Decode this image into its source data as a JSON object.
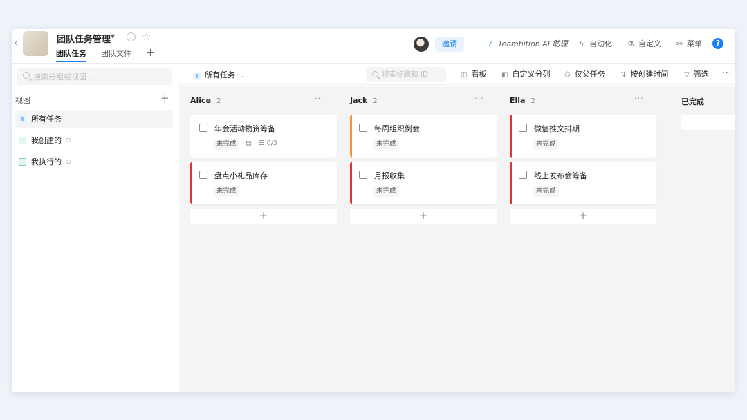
{
  "project": {
    "title": "团队任务管理",
    "tabs": [
      {
        "label": "团队任务"
      },
      {
        "label": "团队文件"
      }
    ]
  },
  "header": {
    "invite_label": "邀请",
    "ai_label": "Teambition AI 助理",
    "automation_label": "自动化",
    "custom_label": "自定义",
    "menu_label": "菜单",
    "help_label": "?"
  },
  "sidebar": {
    "search_placeholder": "搜索分组或视图 ...",
    "section_label": "视图",
    "views": [
      {
        "label": "所有任务",
        "icon": "kanban-icon"
      },
      {
        "label": "我创建的",
        "icon": "table-icon"
      },
      {
        "label": "我执行的",
        "icon": "table-icon"
      }
    ]
  },
  "toolbar": {
    "current_view": "所有任务",
    "search_placeholder": "搜索标题和 ID",
    "buttons": [
      {
        "label": "看板",
        "icon": "board-icon"
      },
      {
        "label": "自定义分列",
        "icon": "columns-icon"
      },
      {
        "label": "仅父任务",
        "icon": "hierarchy-icon"
      },
      {
        "label": "按创建时间",
        "icon": "sort-icon"
      },
      {
        "label": "筛选",
        "icon": "filter-icon"
      }
    ]
  },
  "board": {
    "columns": [
      {
        "name": "Alice",
        "count": "2",
        "cards": [
          {
            "title": "年会活动物资筹备",
            "status": "未完成",
            "subtasks": "0/3",
            "color": "#ffffff"
          },
          {
            "title": "盘点小礼品库存",
            "status": "未完成",
            "color": "#d9363e"
          }
        ]
      },
      {
        "name": "Jack",
        "count": "2",
        "cards": [
          {
            "title": "每周组织例会",
            "status": "未完成",
            "color": "#f0953a"
          },
          {
            "title": "月报收集",
            "status": "未完成",
            "color": "#d9363e"
          }
        ]
      },
      {
        "name": "Ella",
        "count": "2",
        "cards": [
          {
            "title": "微信推文排期",
            "status": "未完成",
            "color": "#d9363e"
          },
          {
            "title": "线上发布会筹备",
            "status": "未完成",
            "color": "#d9363e"
          }
        ]
      },
      {
        "name": "已完成"
      }
    ]
  },
  "colors": {
    "accent": "#1b7ef2",
    "priority_high": "#d9363e",
    "priority_medium": "#f0953a"
  }
}
